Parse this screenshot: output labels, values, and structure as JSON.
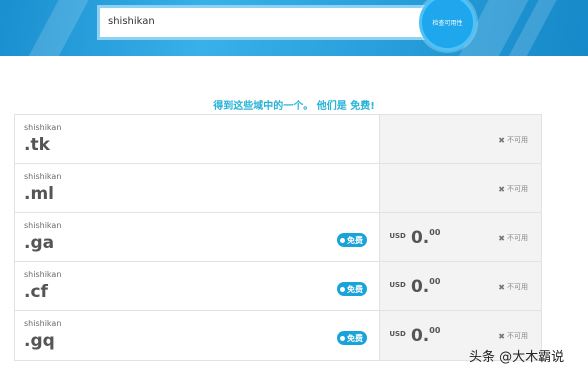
{
  "search": {
    "value": "shishikan",
    "button_label": "检查可用性"
  },
  "headline": "得到这些域中的一个。 他们是 免费!",
  "domains": [
    {
      "sld": "shishikan",
      "tld": ".tk",
      "free": false,
      "price": null,
      "status": "不可用"
    },
    {
      "sld": "shishikan",
      "tld": ".ml",
      "free": false,
      "price": null,
      "status": "不可用"
    },
    {
      "sld": "shishikan",
      "tld": ".ga",
      "free": true,
      "badge": "免费",
      "price": {
        "currency": "USD",
        "main": "0.",
        "decimals": "00"
      },
      "status": "不可用"
    },
    {
      "sld": "shishikan",
      "tld": ".cf",
      "free": true,
      "badge": "免费",
      "price": {
        "currency": "USD",
        "main": "0.",
        "decimals": "00"
      },
      "status": "不可用"
    },
    {
      "sld": "shishikan",
      "tld": ".gq",
      "free": true,
      "badge": "免费",
      "price": {
        "currency": "USD",
        "main": "0.",
        "decimals": "00"
      },
      "status": "不可用"
    }
  ],
  "watermark": "头条 @大木霸说",
  "colors": {
    "accent": "#27b3d7",
    "badge": "#1aa3d9",
    "banner": "#2ba2dd"
  },
  "icons": {
    "unavailable": "x-icon"
  }
}
